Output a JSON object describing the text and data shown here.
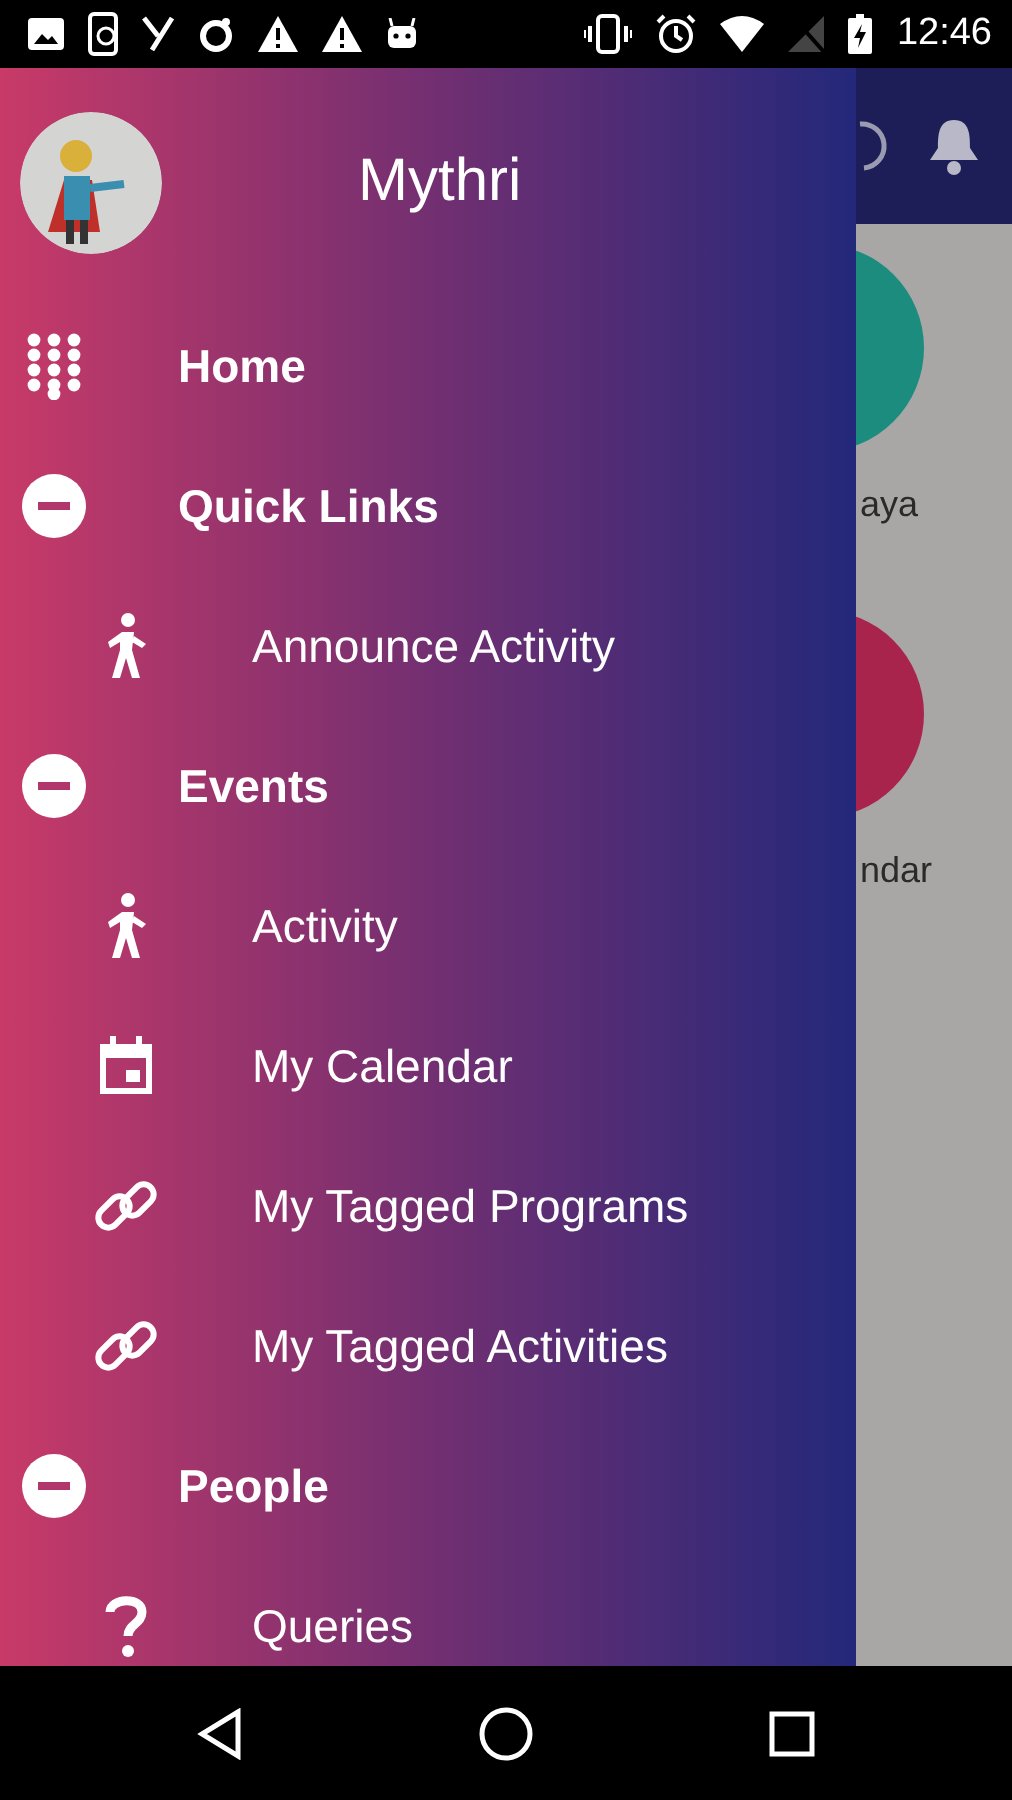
{
  "status_bar": {
    "time": "12:46"
  },
  "background_screen": {
    "tiles": [
      {
        "label": "aya",
        "color": "#1b8c7e"
      },
      {
        "label": "ndar",
        "color": "#a8244c"
      }
    ]
  },
  "drawer": {
    "user_name": "Mythri",
    "menu": [
      {
        "label": "Home",
        "kind": "home"
      },
      {
        "label": "Quick Links",
        "kind": "section",
        "expanded": true,
        "children": [
          {
            "label": "Announce Activity",
            "kind": "walk"
          }
        ]
      },
      {
        "label": "Events",
        "kind": "section",
        "expanded": true,
        "children": [
          {
            "label": "Activity",
            "kind": "walk"
          },
          {
            "label": "My Calendar",
            "kind": "calendar"
          },
          {
            "label": "My Tagged Programs",
            "kind": "link"
          },
          {
            "label": "My Tagged Activities",
            "kind": "link"
          }
        ]
      },
      {
        "label": "People",
        "kind": "section",
        "expanded": true,
        "children": [
          {
            "label": "Queries",
            "kind": "help"
          }
        ]
      }
    ]
  }
}
